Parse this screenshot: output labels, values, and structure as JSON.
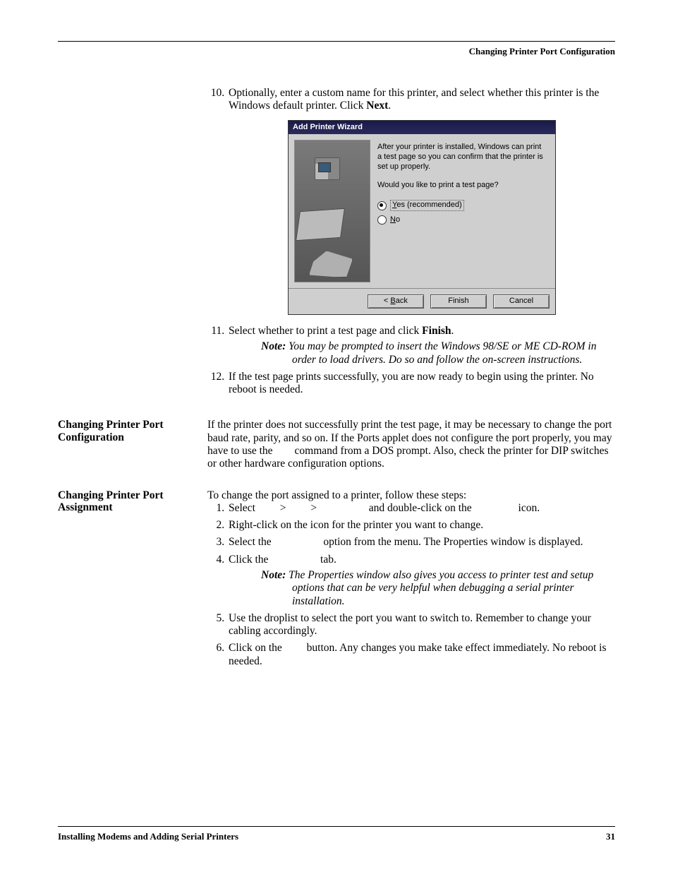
{
  "running_header": "Changing Printer Port Configuration",
  "steps_a": {
    "start": 10,
    "items": [
      {
        "text": "Optionally, enter a custom name for this printer, and select whether this printer is the Windows default printer. Click ",
        "bold_tail": "Next",
        "after": "."
      }
    ]
  },
  "wizard": {
    "title": "Add Printer Wizard",
    "line1": "After your printer is installed, Windows can print a test page so you can confirm that the printer is set up properly.",
    "question": "Would you like to print a test page?",
    "opt_yes_pre": "Y",
    "opt_yes_rest": "es (recommended)",
    "opt_no_pre": "N",
    "opt_no_rest": "o",
    "btn_back_pre": "< ",
    "btn_back_u": "B",
    "btn_back_rest": "ack",
    "btn_finish": "Finish",
    "btn_cancel": "Cancel"
  },
  "steps_b": {
    "start": 11,
    "items": [
      {
        "text": "Select whether to print a test page and click ",
        "bold_tail": "Finish",
        "after": ".",
        "note": "You may be prompted to insert the Windows 98/SE or ME CD-ROM in order to load drivers. Do so and follow the on-screen instructions."
      },
      {
        "text": "If the test page prints successfully, you are now ready to begin using the printer. No reboot is needed."
      }
    ]
  },
  "section_config": {
    "heading": "Changing Printer Port Configuration",
    "body_a": "If the printer does not successfully print the test page, it may be necessary to change the port baud rate, parity, and so on. If the Ports applet does not configure the port properly, you may have to use the ",
    "body_b": " command from a DOS prompt. Also, check the printer for DIP switches or other hardware configuration options."
  },
  "section_assign": {
    "heading": "Changing Printer Port Assignment",
    "intro": "To change the port assigned to a printer, follow these steps:",
    "steps": [
      {
        "pre": "Select ",
        "mid1": "    >    ",
        "mid2": "    >    ",
        "mid3": " and double-click on the ",
        "tail": " icon."
      },
      {
        "text": "Right-click on the icon for the printer you want to change."
      },
      {
        "pre": "Select the ",
        "post": " option from the menu. The Properties window is displayed."
      },
      {
        "pre": "Click the ",
        "post": " tab.",
        "note": "The Properties window also gives you access to printer test and setup options that can be very helpful when debugging a serial printer installation."
      },
      {
        "text": "Use the droplist to select the port you want to switch to. Remember to change your cabling accordingly."
      },
      {
        "pre": "Click on the ",
        "post": " button. Any changes you make take effect immediately. No reboot is needed."
      }
    ]
  },
  "note_label": "Note:",
  "footer": {
    "left": "Installing Modems and Adding Serial Printers",
    "right": "31"
  }
}
